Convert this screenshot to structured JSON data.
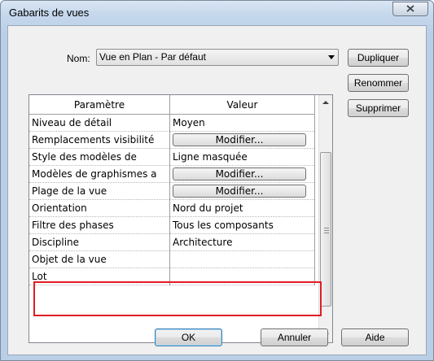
{
  "window": {
    "title": "Gabarits de vues"
  },
  "nom": {
    "label": "Nom:",
    "value": "Vue en Plan - Par défaut"
  },
  "side_buttons": {
    "duplicate": "Dupliquer",
    "rename": "Renommer",
    "delete": "Supprimer"
  },
  "grid": {
    "headers": {
      "param": "Paramètre",
      "value": "Valeur"
    },
    "rows": [
      {
        "param": "Niveau de détail",
        "value": "Moyen",
        "is_button": false
      },
      {
        "param": "Remplacements visibilité",
        "value": "Modifier...",
        "is_button": true
      },
      {
        "param": "Style des modèles de",
        "value": "Ligne masquée",
        "is_button": false
      },
      {
        "param": "Modèles de graphismes a",
        "value": "Modifier...",
        "is_button": true
      },
      {
        "param": "Plage de la vue",
        "value": "Modifier...",
        "is_button": true
      },
      {
        "param": "Orientation",
        "value": "Nord du projet",
        "is_button": false
      },
      {
        "param": "Filtre des phases",
        "value": "Tous les composants",
        "is_button": false
      },
      {
        "param": "Discipline",
        "value": "Architecture",
        "is_button": false
      },
      {
        "param": "Objet de la vue",
        "value": "",
        "is_button": false
      },
      {
        "param": "Lot",
        "value": "",
        "is_button": false
      }
    ]
  },
  "footer_buttons": {
    "ok": "OK",
    "cancel": "Annuler",
    "help": "Aide"
  },
  "colors": {
    "highlight_border": "#e11c24",
    "title_bar": "#c6d8ec"
  }
}
